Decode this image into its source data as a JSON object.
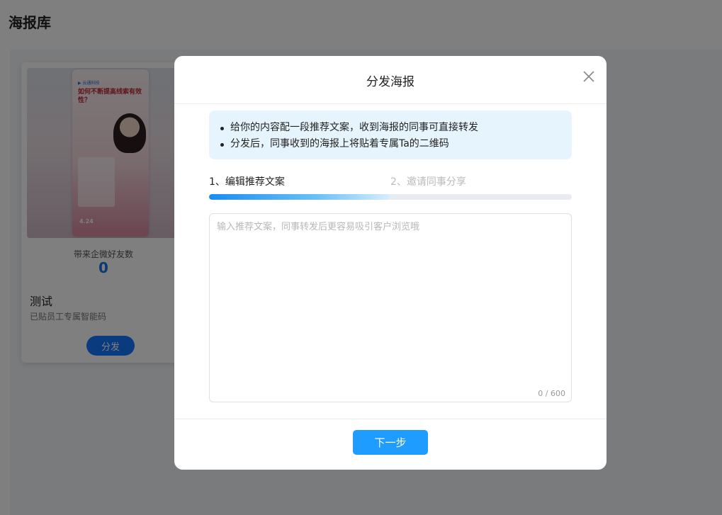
{
  "page": {
    "title": "海报库"
  },
  "poster_card": {
    "thumbnail_brand": "▶ 云通科技",
    "thumbnail_headline": "如何不断提高线索有效性？",
    "thumbnail_date": "4.24",
    "friends_label": "带来企微好友数",
    "friends_count": "0",
    "name": "测试",
    "subtitle": "已贴员工专属智能码",
    "distribute_button": "分发"
  },
  "modal": {
    "title": "分发海报",
    "close_icon": "close-icon",
    "tips": [
      "给你的内容配一段推荐文案，收到海报的同事可直接转发",
      "分发后，同事收到的海报上将贴着专属Ta的二维码"
    ],
    "steps": [
      {
        "label": "1、编辑推荐文案",
        "active": true
      },
      {
        "label": "2、邀请同事分享",
        "active": false
      }
    ],
    "progress": 0.5,
    "textarea": {
      "placeholder": "输入推荐文案，同事转发后更容易吸引客户浏览哦",
      "value": "",
      "counter": "0 / 600"
    },
    "next_button": "下一步"
  },
  "colors": {
    "primary": "#1f9cff",
    "tip_bg": "#e6f4fd",
    "mask": "rgba(0,0,0,0.5)"
  }
}
